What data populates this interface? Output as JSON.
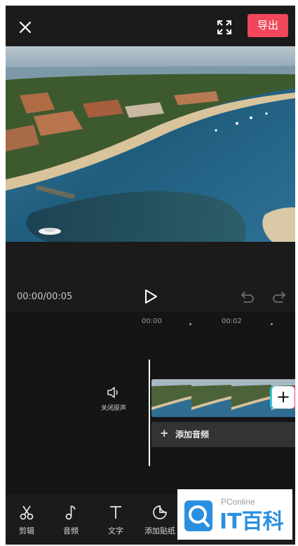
{
  "header": {
    "close_icon": "close-icon",
    "fullscreen_icon": "fullscreen-icon",
    "export_label": "导出"
  },
  "player": {
    "timecode": "00:00/00:05",
    "play_icon": "play-icon",
    "undo_icon": "undo-icon",
    "redo_icon": "redo-icon"
  },
  "timeline": {
    "ruler_ticks": [
      "00:00",
      "00:02"
    ],
    "mute_label": "关闭原声",
    "add_audio_label": "添加音频",
    "add_audio_plus": "+",
    "add_clip_label": "+"
  },
  "toolbar": {
    "items": [
      {
        "label": "剪辑",
        "icon": "scissors-icon"
      },
      {
        "label": "音频",
        "icon": "music-note-icon"
      },
      {
        "label": "文字",
        "icon": "text-icon"
      },
      {
        "label": "添加贴纸",
        "icon": "sticker-icon"
      }
    ]
  },
  "watermark": {
    "top_text": "PConline",
    "brand_text": "IT百科"
  },
  "colors": {
    "accent": "#f0475a",
    "background": "#1b1b1b",
    "timeline_bg": "#151515",
    "brand_blue": "#2a8fe0"
  }
}
